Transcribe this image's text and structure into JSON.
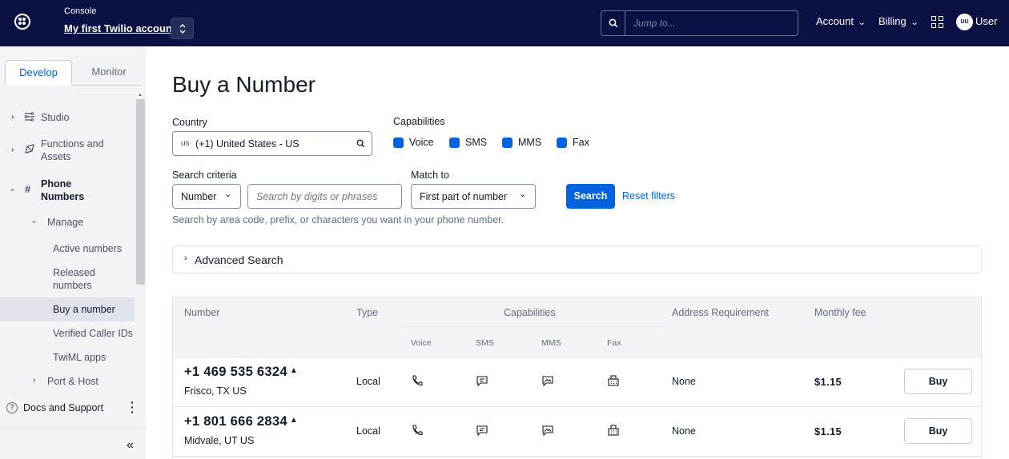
{
  "topbar": {
    "console_label": "Console",
    "account_name": "My first Twilio account",
    "jump_placeholder": "Jump to...",
    "account_menu": "Account",
    "billing_menu": "Billing",
    "avatar_initials": "UU",
    "user_label": "User"
  },
  "sidebar": {
    "tabs": [
      "Develop",
      "Monitor"
    ],
    "items": {
      "studio": "Studio",
      "functions": "Functions and Assets",
      "phone_numbers": "Phone Numbers",
      "manage": "Manage",
      "active": "Active numbers",
      "released": "Released numbers",
      "buy": "Buy a number",
      "verified": "Verified Caller IDs",
      "twiml": "TwiML apps",
      "port": "Port & Host"
    },
    "docs": "Docs and Support"
  },
  "main": {
    "title": "Buy a Number",
    "country_label": "Country",
    "country_code": "us",
    "country_value": "(+1) United States - US",
    "capabilities_label": "Capabilities",
    "capabilities": [
      "Voice",
      "SMS",
      "MMS",
      "Fax"
    ],
    "search_criteria_label": "Search criteria",
    "criteria_value": "Number",
    "search_placeholder": "Search by digits or phrases",
    "match_label": "Match to",
    "match_value": "First part of number",
    "search_button": "Search",
    "reset_link": "Reset filters",
    "helper_text": "Search by area code, prefix, or characters you want in your phone number.",
    "advanced_search": "Advanced Search"
  },
  "table": {
    "headers": {
      "number": "Number",
      "type": "Type",
      "capabilities": "Capabilities",
      "address": "Address Requirement",
      "fee": "Monthly fee"
    },
    "sub_headers": [
      "Voice",
      "SMS",
      "MMS",
      "Fax"
    ],
    "rows": [
      {
        "number": "+1 469 535 6324",
        "location": "Frisco, TX US",
        "type": "Local",
        "address": "None",
        "fee": "$1.15",
        "action": "Buy"
      },
      {
        "number": "+1 801 666 2834",
        "location": "Midvale, UT US",
        "type": "Local",
        "address": "None",
        "fee": "$1.15",
        "action": "Buy"
      }
    ]
  },
  "colors": {
    "topbar": "#0b1145",
    "accent": "#0263e0",
    "sidebar_bg": "#f4f4f6"
  },
  "icons": {
    "phone": "phone-icon",
    "sms": "sms-icon",
    "mms": "mms-icon",
    "fax": "fax-icon"
  }
}
